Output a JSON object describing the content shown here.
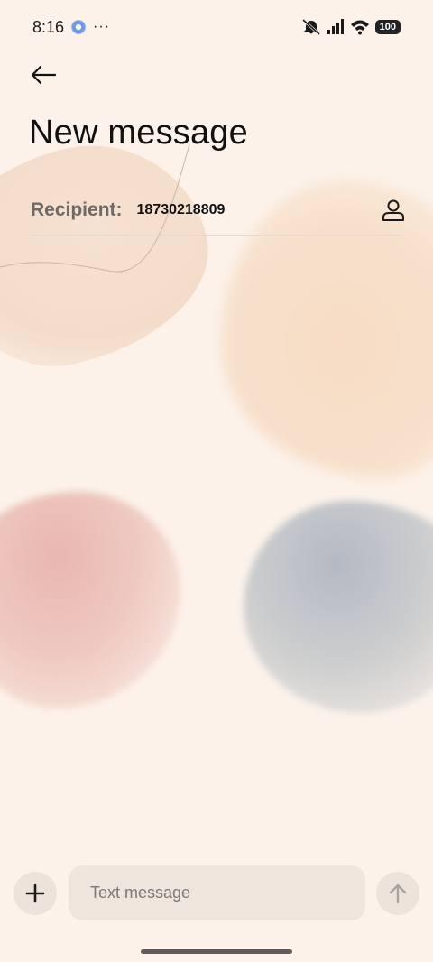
{
  "status_bar": {
    "time": "8:16",
    "overflow": "···",
    "battery": "100",
    "icons": [
      "app-notification-icon",
      "mute-icon",
      "signal-icon",
      "wifi-icon",
      "battery-icon"
    ]
  },
  "header": {
    "back_icon": "back-arrow-icon",
    "title": "New message"
  },
  "recipient": {
    "label": "Recipient:",
    "value": "18730218809",
    "contact_icon": "contact-person-icon"
  },
  "composer": {
    "add_icon": "plus-icon",
    "placeholder": "Text message",
    "send_icon": "send-arrow-icon"
  }
}
